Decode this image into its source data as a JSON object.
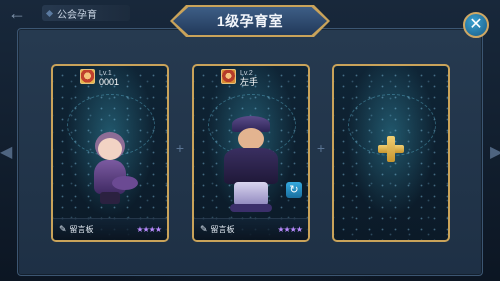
{
  "header": {
    "back_icon": "back-arrow-icon",
    "breadcrumb_label": "公会孕育"
  },
  "dialog": {
    "title": "1级孕育室",
    "close_label": "✕"
  },
  "slots": [
    {
      "level": "Lv.1",
      "name": "0001",
      "message_label": "留言板",
      "rank": "★★★★"
    },
    {
      "level": "Lv.2",
      "name": "左手",
      "message_label": "留言板",
      "rank": "★★★★"
    },
    {
      "empty": true,
      "icon": "plus-icon"
    }
  ],
  "connectors": [
    "+",
    "+"
  ],
  "colors": {
    "gold_border": "#c9a35a",
    "accent_blue": "#2a8fc5",
    "rank_purple": "#b98bff"
  }
}
